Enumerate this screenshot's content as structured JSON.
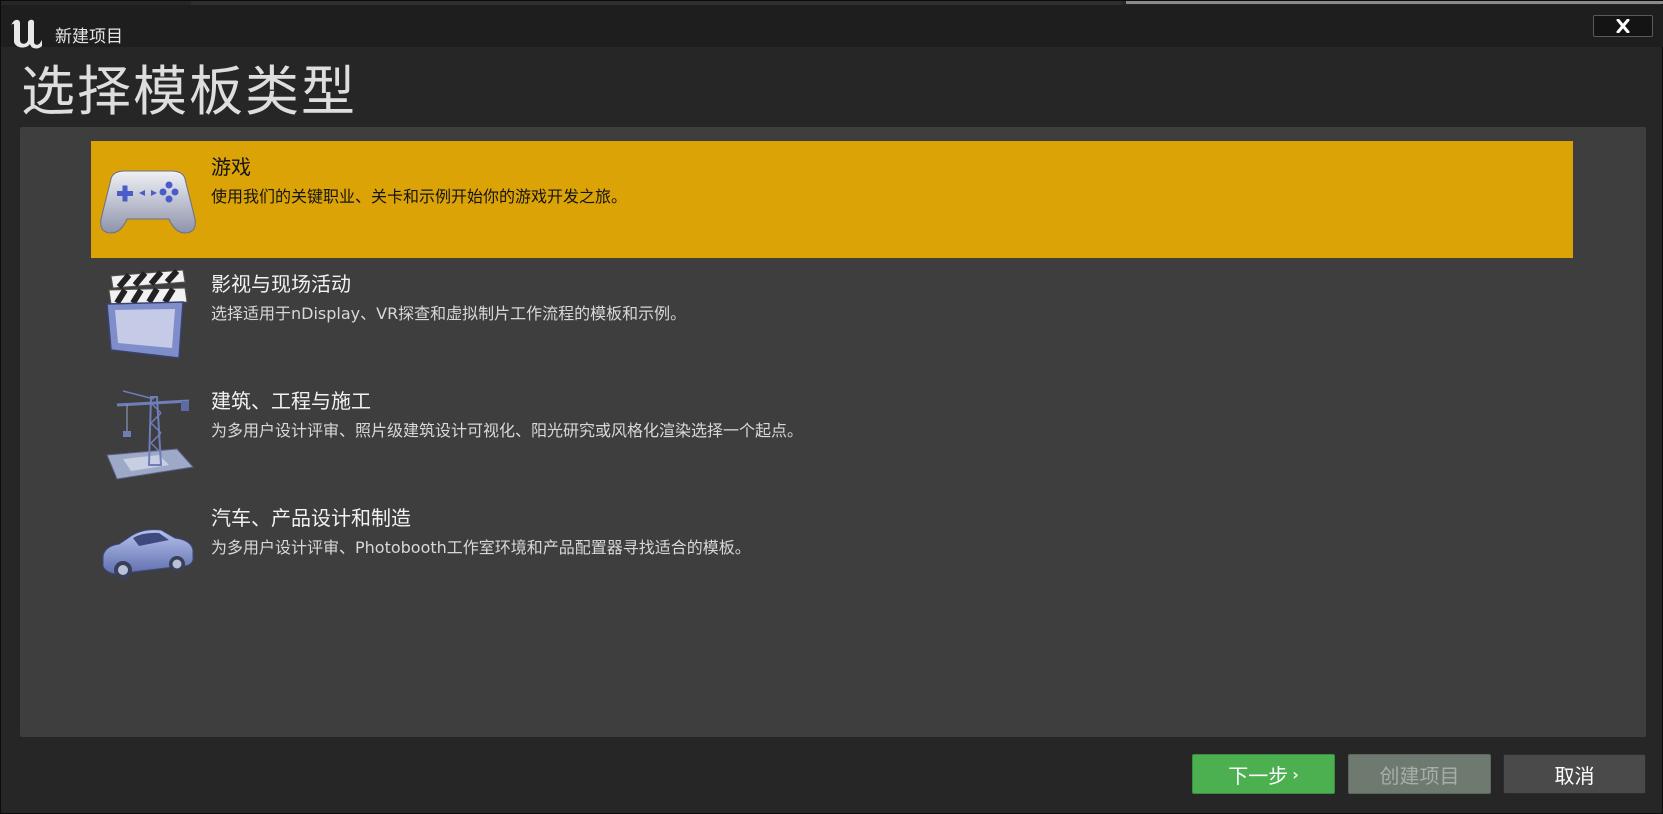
{
  "window": {
    "title": "新建项目",
    "close_label": "✕"
  },
  "heading": "选择模板类型",
  "templates": [
    {
      "name": "游戏",
      "description": "使用我们的关键职业、关卡和示例开始你的游戏开发之旅。",
      "icon": "gamepad-icon",
      "selected": true
    },
    {
      "name": "影视与现场活动",
      "description": "选择适用于nDisplay、VR探查和虚拟制片工作流程的模板和示例。",
      "icon": "clapperboard-icon",
      "selected": false
    },
    {
      "name": "建筑、工程与施工",
      "description": "为多用户设计评审、照片级建筑设计可视化、阳光研究或风格化渲染选择一个起点。",
      "icon": "crane-icon",
      "selected": false
    },
    {
      "name": "汽车、产品设计和制造",
      "description": "为多用户设计评审、Photobooth工作室环境和产品配置器寻找适合的模板。",
      "icon": "car-icon",
      "selected": false
    }
  ],
  "footer": {
    "next_label": "下一步",
    "next_chevron": "›",
    "create_label": "创建项目",
    "cancel_label": "取消"
  },
  "colors": {
    "selected_row": "#dca307",
    "next_button": "#4caf50",
    "create_button_disabled": "#6e7a70",
    "cancel_button": "#4a4a4a"
  }
}
